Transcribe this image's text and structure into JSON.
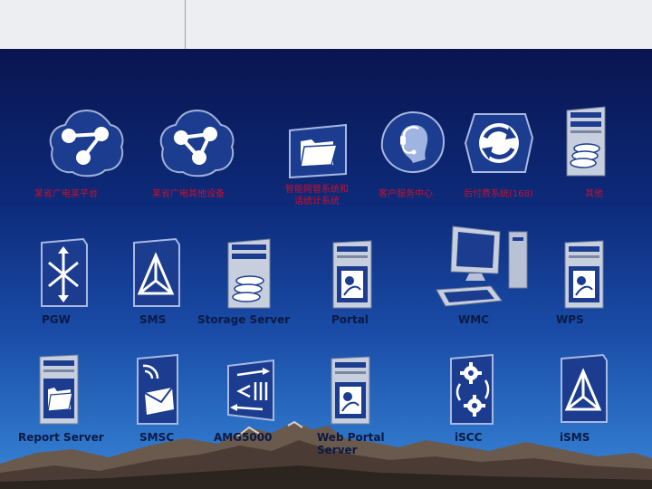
{
  "colors": {
    "sky_top": "#0a1550",
    "sky_bottom": "#3c86d6",
    "label": "#0b1a44",
    "label_cn": "#c8102e",
    "icon_face": "#1c3d8f"
  },
  "row1": [
    {
      "label": "某省广电某平台",
      "icon": "network-node-icon"
    },
    {
      "label": "某省广电其他设备",
      "icon": "network-node-icon"
    },
    {
      "label_line1": "智能网管系统和",
      "label_line2": "话统计系统",
      "icon": "folder-icon"
    },
    {
      "label": "客户服务中心",
      "icon": "customer-service-icon"
    },
    {
      "label": "后付费系统(168)",
      "icon": "sync-icon"
    },
    {
      "label": "其他",
      "icon": "database-icon"
    }
  ],
  "row2": [
    {
      "label": "PGW",
      "icon": "switch-arrows-icon"
    },
    {
      "label": "SMS",
      "icon": "triangle-node-icon"
    },
    {
      "label": "Storage Server",
      "icon": "storage-server-icon"
    },
    {
      "label": "Portal",
      "icon": "portal-server-icon"
    },
    {
      "label": "WMC",
      "icon": "workstation-icon"
    },
    {
      "label": "WPS",
      "icon": "portal-server-icon"
    }
  ],
  "row3": [
    {
      "label": "Report Server",
      "icon": "report-server-icon"
    },
    {
      "label": "SMSC",
      "icon": "sms-envelope-icon"
    },
    {
      "label": "AMG5000",
      "icon": "gateway-icon"
    },
    {
      "label_line1": "Web Portal",
      "label_line2": "Server",
      "icon": "web-portal-server-icon"
    },
    {
      "label": "iSCC",
      "icon": "gear-pair-icon"
    },
    {
      "label": "iSMS",
      "icon": "triangle-node-icon"
    }
  ]
}
